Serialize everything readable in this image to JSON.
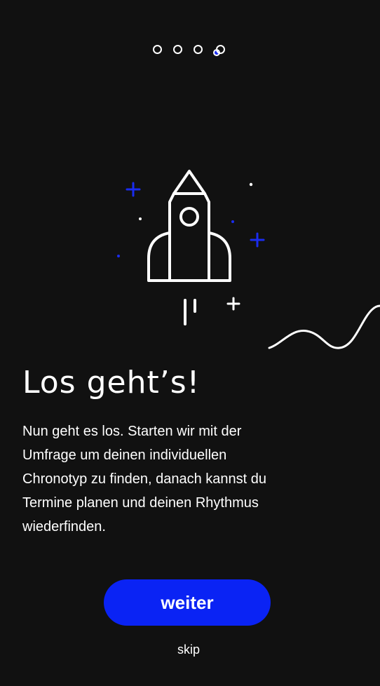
{
  "pagination": {
    "total": 4,
    "current": 4
  },
  "illustration": {
    "icon": "rocket-icon",
    "line_color": "#ffffff",
    "accent_color": "#1a2cf0"
  },
  "headline": "Los geht’s!",
  "body": "Nun geht es los. Starten wir mit der Umfrage um deinen individuellen Chronotyp zu finden, danach kannst du Termine planen und deinen Rhythmus wiederfinden.",
  "next_button": {
    "label": "weiter",
    "color": "#0a23f4"
  },
  "skip_label": "skip",
  "colors": {
    "background": "#111111",
    "text": "#ffffff",
    "accent": "#0a23f4"
  }
}
